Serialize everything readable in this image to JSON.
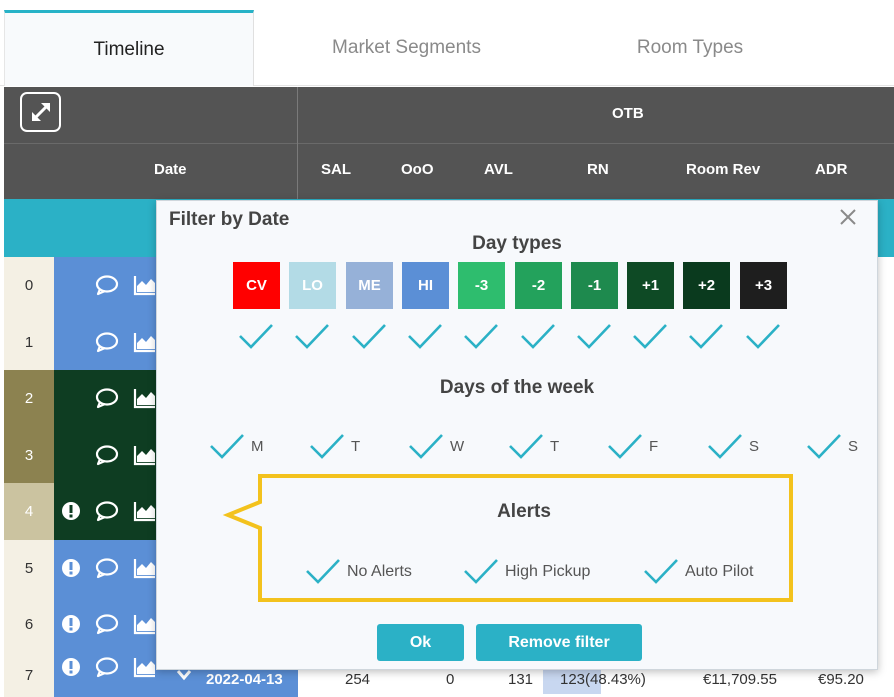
{
  "tabs": [
    {
      "label": "Timeline",
      "active": true
    },
    {
      "label": "Market Segments",
      "active": false
    },
    {
      "label": "Room Types",
      "active": false
    }
  ],
  "header": {
    "group_label": "OTB",
    "columns": [
      "Date",
      "SAL",
      "OoO",
      "AVL",
      "RN",
      "Room Rev",
      "ADR"
    ]
  },
  "rows": [
    {
      "index": "0",
      "color": "#5b8fd6",
      "num_bg": "#f4f0e4",
      "alert": false
    },
    {
      "index": "1",
      "color": "#5b8fd6",
      "num_bg": "#f4f0e4",
      "alert": false
    },
    {
      "index": "2",
      "color": "#0e3d22",
      "num_bg": "#8c8250",
      "alert": false
    },
    {
      "index": "3",
      "color": "#0e3d22",
      "num_bg": "#8c8250",
      "alert": false
    },
    {
      "index": "4",
      "color": "#0e3d22",
      "num_bg": "#cbc3a0",
      "alert": true
    },
    {
      "index": "5",
      "color": "#5b8fd6",
      "num_bg": "#f4f0e4",
      "alert": true
    },
    {
      "index": "6",
      "color": "#5b8fd6",
      "num_bg": "#f4f0e4",
      "alert": true
    },
    {
      "index": "7",
      "color": "#5b8fd6",
      "num_bg": "#f4f0e4",
      "alert": true
    }
  ],
  "last_row": {
    "date": "2022-04-13",
    "sal": "254",
    "ooo": "0",
    "avl": "131",
    "rn": "123(48.43%)",
    "room_rev": "€11,709.55",
    "adr": "€95.20"
  },
  "dialog": {
    "title": "Filter by Date",
    "close_icon": "close-icon",
    "day_types_title": "Day types",
    "day_types": [
      {
        "label": "CV",
        "color": "#ff0000"
      },
      {
        "label": "LO",
        "color": "#b3dbe6"
      },
      {
        "label": "ME",
        "color": "#96b1d8"
      },
      {
        "label": "HI",
        "color": "#5b8fd6"
      },
      {
        "label": "-3",
        "color": "#2ebd6e"
      },
      {
        "label": "-2",
        "color": "#23a25c"
      },
      {
        "label": "-1",
        "color": "#1e8a4e"
      },
      {
        "label": "+1",
        "color": "#0e4a25"
      },
      {
        "label": "+2",
        "color": "#0a3a1e"
      },
      {
        "label": "+3",
        "color": "#1e1e1e"
      }
    ],
    "days_of_week_title": "Days of the week",
    "days_of_week": [
      "M",
      "T",
      "W",
      "T",
      "F",
      "S",
      "S"
    ],
    "alerts_title": "Alerts",
    "alerts": [
      "No Alerts",
      "High Pickup",
      "Auto Pilot"
    ],
    "ok_label": "Ok",
    "remove_label": "Remove filter"
  },
  "colors": {
    "accent": "#2bb1c6",
    "header_bg": "#545454",
    "check": "#2bb1c6",
    "callout": "#f3c21d"
  }
}
